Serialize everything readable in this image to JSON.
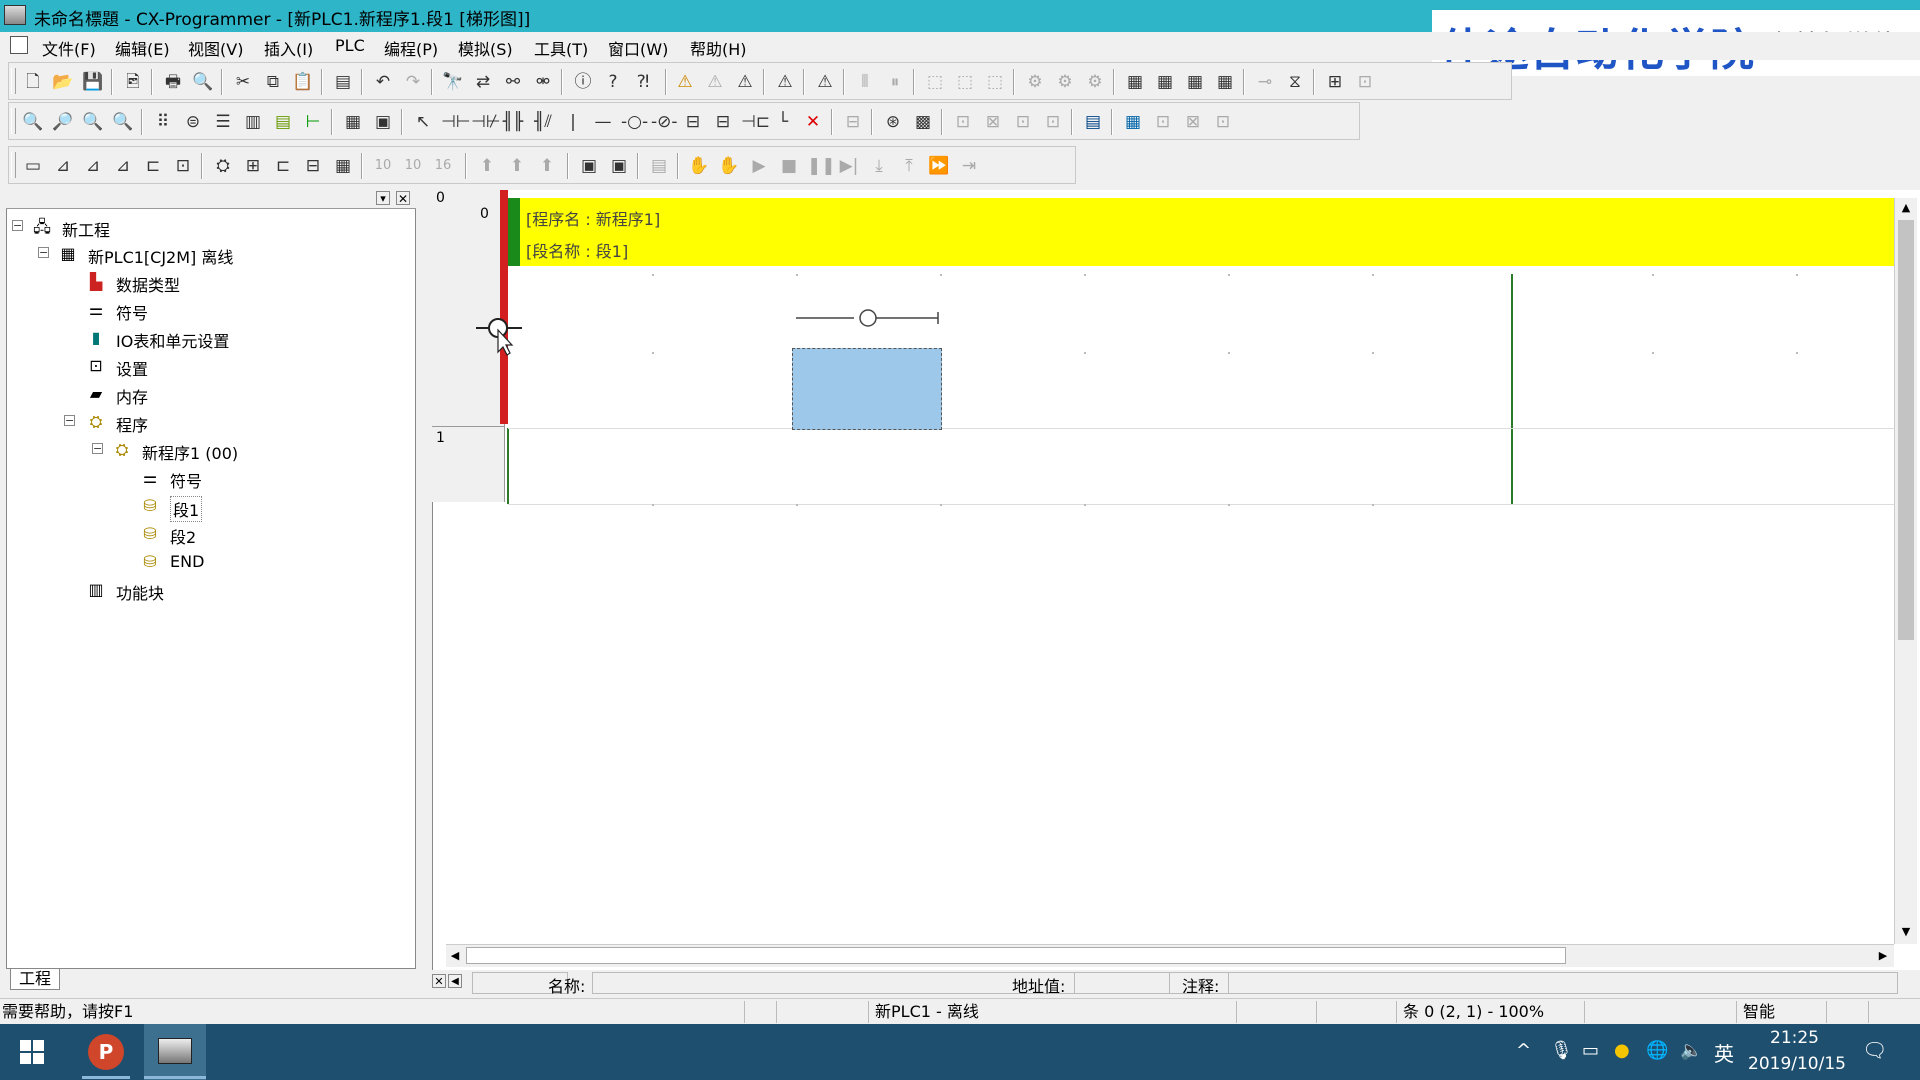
{
  "window": {
    "title": "未命名標題 - CX-Programmer - [新PLC1.新程序1.段1 [梯形图]]"
  },
  "watermark": {
    "brand": "佳途自动化学院",
    "slogan": "为梦想增值!"
  },
  "menu": [
    "文件(F)",
    "编辑(E)",
    "视图(V)",
    "插入(I)",
    "PLC",
    "编程(P)",
    "模拟(S)",
    "工具(T)",
    "窗口(W)",
    "帮助(H)"
  ],
  "toolbar_row3_labels": [
    "10",
    "10",
    "16"
  ],
  "project_tree": {
    "root": "新工程",
    "plc": "新PLC1[CJ2M] 离线",
    "items": [
      "数据类型",
      "符号",
      "IO表和单元设置",
      "设置",
      "内存",
      "程序"
    ],
    "program": "新程序1 (00)",
    "program_items": [
      "符号",
      "段1",
      "段2",
      "END"
    ],
    "function_blocks": "功能块",
    "tab_label": "工程"
  },
  "ladder": {
    "rung0_number": "0",
    "rung0_step": "0",
    "program_name_line": "[程序名 : 新程序1]",
    "section_name_line": "[段名称 : 段1]",
    "rung1_number": "1"
  },
  "fieldbar": {
    "name_label": "名称:",
    "address_label": "地址值:",
    "comment_label": "注释:"
  },
  "statusbar": {
    "help_text": "需要帮助，请按F1",
    "plc_status": "新PLC1 - 离线",
    "position": "条 0 (2, 1)  - 100%",
    "mode": "智能"
  },
  "taskbar": {
    "ime": "英",
    "time": "21:25",
    "date": "2019/10/15"
  },
  "colors": {
    "titlebar": "#2fb5c8",
    "comment_band": "#ffff00",
    "left_rail": "#d21f1f",
    "selection": "#9dc8ea",
    "taskbar": "#1f4f6e",
    "watermark_brand": "#1f55c4"
  }
}
